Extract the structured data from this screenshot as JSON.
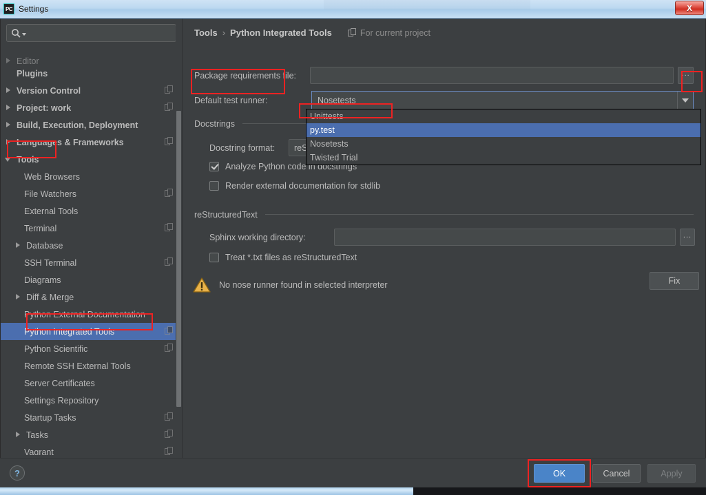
{
  "window": {
    "title": "Settings",
    "icon": "pycharm-icon",
    "close_label": "X"
  },
  "search": {
    "value": "",
    "placeholder": "",
    "icon": "search-icon"
  },
  "sidebar": {
    "clipped_item": "Editor",
    "items": [
      {
        "label": "Plugins",
        "level": 0,
        "arrow": "none",
        "copy": false,
        "selected": false
      },
      {
        "label": "Version Control",
        "level": 0,
        "arrow": "closed",
        "copy": true,
        "selected": false
      },
      {
        "label": "Project: work",
        "level": 0,
        "arrow": "closed",
        "copy": true,
        "selected": false
      },
      {
        "label": "Build, Execution, Deployment",
        "level": 0,
        "arrow": "closed",
        "copy": false,
        "selected": false
      },
      {
        "label": "Languages & Frameworks",
        "level": 0,
        "arrow": "closed",
        "copy": true,
        "selected": false
      },
      {
        "label": "Tools",
        "level": 0,
        "arrow": "open",
        "copy": false,
        "selected": false
      },
      {
        "label": "Web Browsers",
        "level": 1,
        "arrow": "none",
        "copy": false,
        "selected": false
      },
      {
        "label": "File Watchers",
        "level": 1,
        "arrow": "none",
        "copy": true,
        "selected": false
      },
      {
        "label": "External Tools",
        "level": 1,
        "arrow": "none",
        "copy": false,
        "selected": false
      },
      {
        "label": "Terminal",
        "level": 1,
        "arrow": "none",
        "copy": true,
        "selected": false
      },
      {
        "label": "Database",
        "level": 1,
        "arrow": "closed",
        "copy": false,
        "selected": false
      },
      {
        "label": "SSH Terminal",
        "level": 1,
        "arrow": "none",
        "copy": true,
        "selected": false
      },
      {
        "label": "Diagrams",
        "level": 1,
        "arrow": "none",
        "copy": false,
        "selected": false
      },
      {
        "label": "Diff & Merge",
        "level": 1,
        "arrow": "closed",
        "copy": false,
        "selected": false
      },
      {
        "label": "Python External Documentation",
        "level": 1,
        "arrow": "none",
        "copy": false,
        "selected": false
      },
      {
        "label": "Python Integrated Tools",
        "level": 1,
        "arrow": "none",
        "copy": true,
        "selected": true
      },
      {
        "label": "Python Scientific",
        "level": 1,
        "arrow": "none",
        "copy": true,
        "selected": false
      },
      {
        "label": "Remote SSH External Tools",
        "level": 1,
        "arrow": "none",
        "copy": false,
        "selected": false
      },
      {
        "label": "Server Certificates",
        "level": 1,
        "arrow": "none",
        "copy": false,
        "selected": false
      },
      {
        "label": "Settings Repository",
        "level": 1,
        "arrow": "none",
        "copy": false,
        "selected": false
      },
      {
        "label": "Startup Tasks",
        "level": 1,
        "arrow": "none",
        "copy": true,
        "selected": false
      },
      {
        "label": "Tasks",
        "level": 1,
        "arrow": "closed",
        "copy": true,
        "selected": false
      },
      {
        "label": "Vagrant",
        "level": 1,
        "arrow": "none",
        "copy": true,
        "selected": false
      }
    ]
  },
  "breadcrumb": {
    "root": "Tools",
    "separator": "›",
    "page": "Python Integrated Tools",
    "scope_label": "For current project",
    "scope_icon": "copy-icon"
  },
  "form": {
    "package_requirements_label": "Package requirements file:",
    "package_requirements_value": "",
    "browse_label": "...",
    "default_test_runner_label": "Default test runner:",
    "default_test_runner_value": "Nosetests",
    "docstrings_group": "Docstrings",
    "docstring_format_label": "Docstring format:",
    "docstring_format_value": "reSt",
    "analyze_docstrings_label": "Analyze Python code in docstrings",
    "analyze_docstrings_checked": true,
    "render_external_label": "Render external documentation for stdlib",
    "render_external_checked": false,
    "restructuredtext_group": "reStructuredText",
    "sphinx_dir_label": "Sphinx working directory:",
    "sphinx_dir_value": "",
    "treat_txt_label": "Treat *.txt files as reStructuredText",
    "treat_txt_checked": false
  },
  "warning": {
    "icon": "warning-triangle-icon",
    "message": "No nose runner found in selected interpreter",
    "fix_label": "Fix"
  },
  "dropdown": {
    "open": true,
    "options": [
      {
        "label": "Unittests",
        "selected": false
      },
      {
        "label": "py.test",
        "selected": true
      },
      {
        "label": "Nosetests",
        "selected": false
      },
      {
        "label": "Twisted Trial",
        "selected": false
      }
    ]
  },
  "footer": {
    "help_label": "?",
    "ok_label": "OK",
    "cancel_label": "Cancel",
    "apply_label": "Apply"
  },
  "colors": {
    "accent_blue": "#4b6eaf",
    "ok_button": "#4a84c8",
    "annotation_red": "#ee2222",
    "panel_bg": "#3c3f41",
    "field_bg": "#45494a",
    "warning_amber": "#e8b24a"
  },
  "annotations": [
    {
      "name": "default-test-runner-label"
    },
    {
      "name": "combo-arrow-button"
    },
    {
      "name": "pytest-option"
    },
    {
      "name": "tools-tree-node"
    },
    {
      "name": "python-integrated-tools-node"
    },
    {
      "name": "ok-button"
    }
  ]
}
